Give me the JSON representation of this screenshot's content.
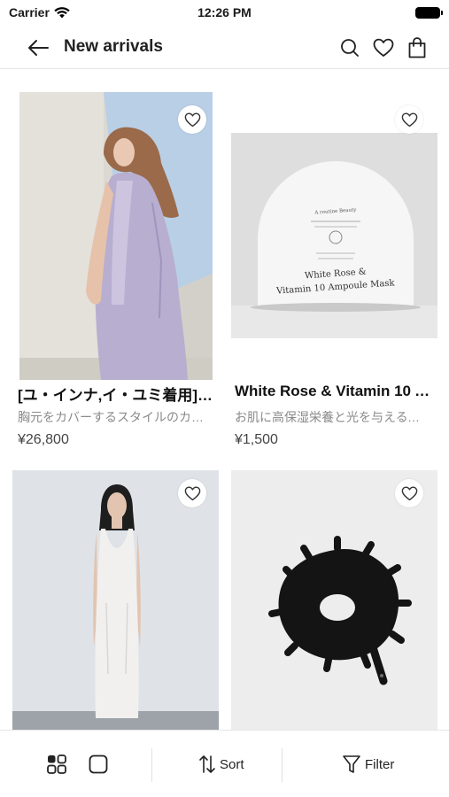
{
  "status_bar": {
    "carrier": "Carrier",
    "time": "12:26 PM"
  },
  "nav": {
    "title": "New arrivals"
  },
  "products": [
    {
      "title": "[ユ・インナ,イ・ユミ着用]ラスティドレス",
      "description": "胸元をカバーするスタイルのカットアウトドレス",
      "price": "¥26,800"
    },
    {
      "title": "White Rose & Vitamin 10 Ampoule Mask",
      "description": "お肌に高保湿栄養と光を与えるマスク",
      "price": "¥1,500",
      "mask_lines": [
        "A routine Beauty",
        "White Rose &",
        "Vitamin 10 Ampoule Mask"
      ]
    },
    {
      "title": "",
      "description": "",
      "price": ""
    },
    {
      "title": "",
      "description": "",
      "price": ""
    }
  ],
  "toolbar": {
    "sort_label": "Sort",
    "filter_label": "Filter"
  }
}
